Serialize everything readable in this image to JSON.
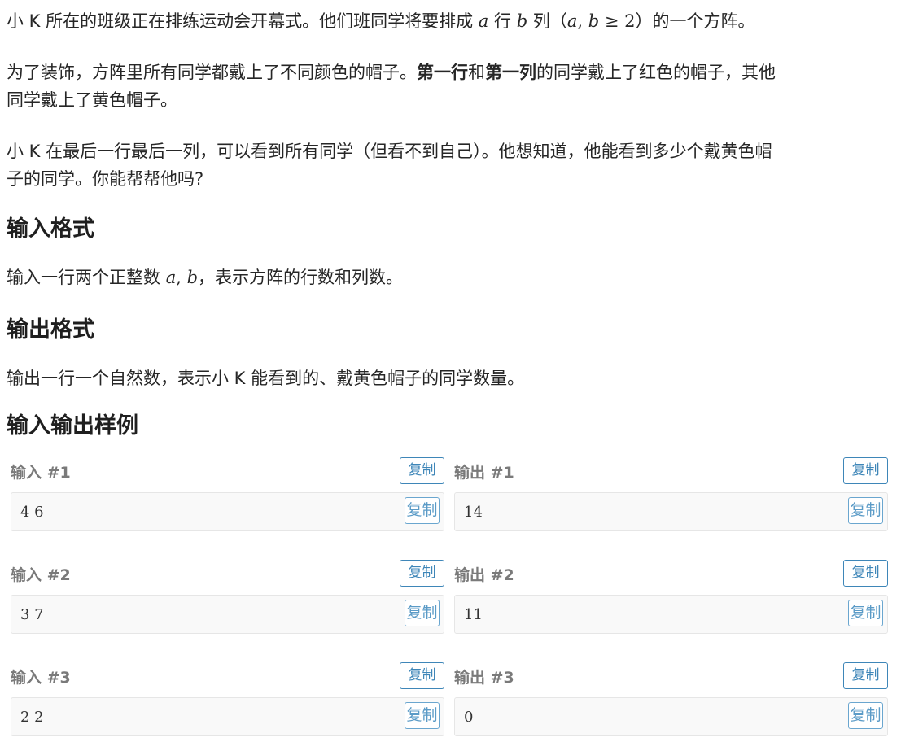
{
  "problem": {
    "para1": {
      "prefix": "小 K 所在的班级正在排练运动会开幕式。他们班同学将要排成 ",
      "var_a": "a",
      "mid1": " 行 ",
      "var_b": "b",
      "mid2": " 列（",
      "cond_a": "a",
      "cond_comma": ", ",
      "cond_b": "b",
      "cond_rest": " ≥ 2",
      "suffix": "）的一个方阵。"
    },
    "para2": {
      "prefix": "为了装饰，方阵里所有同学都戴上了不同颜色的帽子。",
      "bold1": "第一行",
      "mid": "和",
      "bold2": "第一列",
      "suffix1": "的同学戴上了红色的帽子，其他",
      "line2": "同学戴上了黄色帽子。"
    },
    "para3": {
      "line1": "小 K 在最后一行最后一列，可以看到所有同学（但看不到自己）。他想知道，他能看到多少个戴黄色帽",
      "line2": "子的同学。你能帮帮他吗?"
    }
  },
  "input_format": {
    "heading": "输入格式",
    "text_prefix": "输入一行两个正整数 ",
    "var_a": "a",
    "comma": ", ",
    "var_b": "b",
    "text_suffix": "，表示方阵的行数和列数。"
  },
  "output_format": {
    "heading": "输出格式",
    "text": "输出一行一个自然数，表示小 K 能看到的、戴黄色帽子的同学数量。"
  },
  "samples": {
    "heading": "输入输出样例",
    "copy_label": "复制",
    "items": [
      {
        "input_title": "输入 #1",
        "input": "4 6",
        "output_title": "输出 #1",
        "output": "14"
      },
      {
        "input_title": "输入 #2",
        "input": "3 7",
        "output_title": "输出 #2",
        "output": "11"
      },
      {
        "input_title": "输入 #3",
        "input": "2 2",
        "output_title": "输出 #3",
        "output": "0"
      }
    ]
  },
  "colors": {
    "accent": "#3e86b8",
    "code_bg": "#f9f9f9",
    "sample_title": "#7a7a7a"
  }
}
